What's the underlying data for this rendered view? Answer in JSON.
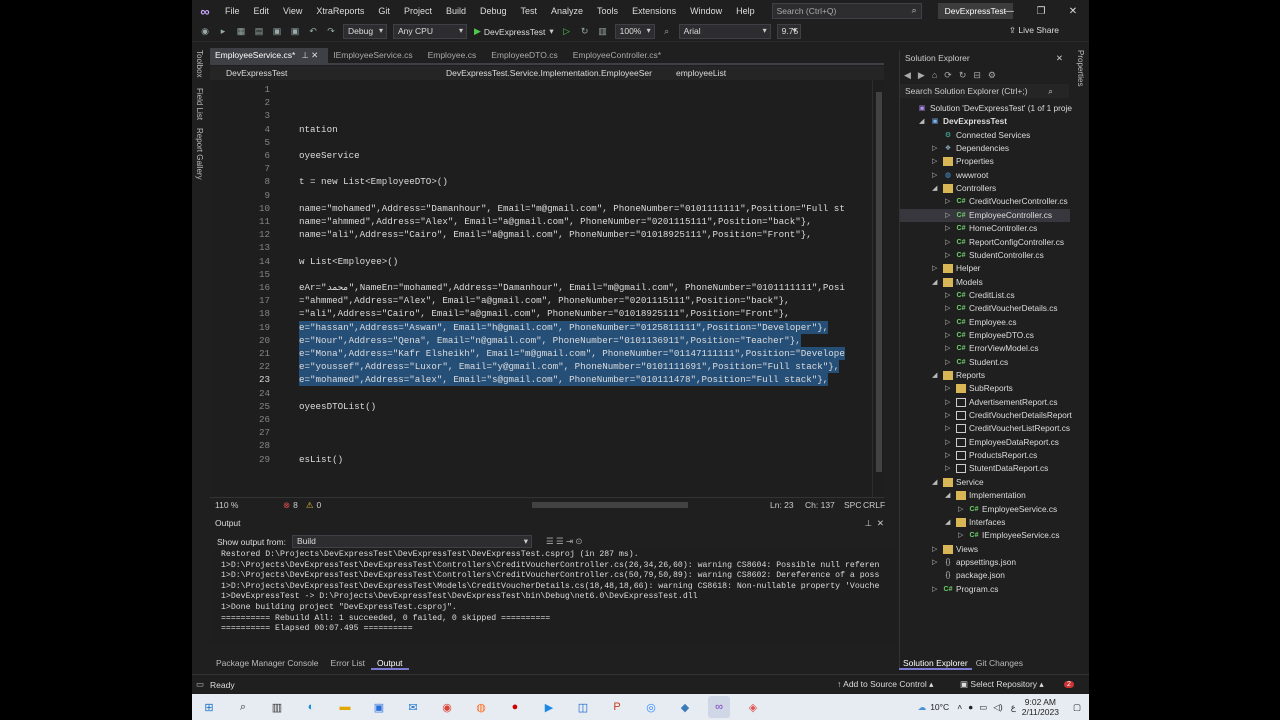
{
  "titlebar": {
    "menu": [
      "File",
      "Edit",
      "View",
      "XtraReports",
      "Git",
      "Project",
      "Build",
      "Debug",
      "Test",
      "Analyze",
      "Tools",
      "Extensions",
      "Window",
      "Help"
    ],
    "search_placeholder": "Search (Ctrl+Q)",
    "solution_name": "DevExpressTest"
  },
  "toolbar": {
    "config": "Debug",
    "platform": "Any CPU",
    "run_target": "DevExpressTest",
    "zoom": "100%",
    "font": "Arial",
    "font_size": "9.75",
    "live_share": "Live Share"
  },
  "left_strip": [
    "Toolbox",
    "Field List",
    "Report Gallery"
  ],
  "right_strip": [
    "Properties"
  ],
  "tabs": [
    {
      "label": "EmployeeService.cs*",
      "active": true
    },
    {
      "label": "IEmployeeService.cs",
      "active": false
    },
    {
      "label": "Employee.cs",
      "active": false
    },
    {
      "label": "EmployeeDTO.cs",
      "active": false
    },
    {
      "label": "EmployeeController.cs*",
      "active": false
    }
  ],
  "navbar": {
    "project": "DevExpressTest",
    "type": "DevExpressTest.Service.Implementation.EmployeeSer",
    "member": "employeeList"
  },
  "code_lines": [
    {
      "n": "1",
      "t": ""
    },
    {
      "n": "2",
      "t": ""
    },
    {
      "n": "3",
      "t": ""
    },
    {
      "n": "4",
      "t": "ntation"
    },
    {
      "n": "5",
      "t": ""
    },
    {
      "n": "6",
      "t": "oyeeService"
    },
    {
      "n": "7",
      "t": ""
    },
    {
      "n": "8",
      "t": "t = new List<EmployeeDTO>()"
    },
    {
      "n": "9",
      "t": ""
    },
    {
      "n": "10",
      "t": "name=\"mohamed\",Address=\"Damanhour\", Email=\"m@gmail.com\", PhoneNumber=\"0101111111\",Position=\"Full st"
    },
    {
      "n": "11",
      "t": "name=\"ahmmed\",Address=\"Alex\", Email=\"a@gmail.com\", PhoneNumber=\"0201115111\",Position=\"back\"},"
    },
    {
      "n": "12",
      "t": "name=\"ali\",Address=\"Cairo\", Email=\"a@gmail.com\", PhoneNumber=\"01018925111\",Position=\"Front\"},"
    },
    {
      "n": "13",
      "t": ""
    },
    {
      "n": "14",
      "t": "w List<Employee>()"
    },
    {
      "n": "15",
      "t": ""
    },
    {
      "n": "16",
      "t": "eAr=\"محمد\",NameEn=\"mohamed\",Address=\"Damanhour\", Email=\"m@gmail.com\", PhoneNumber=\"0101111111\",Posi"
    },
    {
      "n": "17",
      "t": "=\"ahmmed\",Address=\"Alex\", Email=\"a@gmail.com\", PhoneNumber=\"0201115111\",Position=\"back\"},"
    },
    {
      "n": "18",
      "t": "=\"ali\",Address=\"Cairo\", Email=\"a@gmail.com\", PhoneNumber=\"01018925111\",Position=\"Front\"},"
    },
    {
      "n": "19",
      "t": "e=\"hassan\",Address=\"Aswan\", Email=\"h@gmail.com\", PhoneNumber=\"0125811111\",Position=\"Developer\"},"
    },
    {
      "n": "20",
      "t": "e=\"Nour\",Address=\"Qena\", Email=\"n@gmail.com\", PhoneNumber=\"0101136911\",Position=\"Teacher\"},"
    },
    {
      "n": "21",
      "t": "e=\"Mona\",Address=\"Kafr Elsheikh\", Email=\"m@gmail.com\", PhoneNumber=\"01147111111\",Position=\"Develope"
    },
    {
      "n": "22",
      "t": "e=\"youssef\",Address=\"Luxor\", Email=\"y@gmail.com\", PhoneNumber=\"0101111691\",Position=\"Full stack\"},"
    },
    {
      "n": "23",
      "t": "e=\"mohamed\",Address=\"alex\", Email=\"s@gmail.com\", PhoneNumber=\"010111478\",Position=\"Full stack\"},"
    },
    {
      "n": "24",
      "t": ""
    },
    {
      "n": "25",
      "t": "oyeesDTOList()"
    },
    {
      "n": "26",
      "t": ""
    },
    {
      "n": "27",
      "t": ""
    },
    {
      "n": "28",
      "t": ""
    },
    {
      "n": "29",
      "t": "esList()"
    }
  ],
  "editor_status": {
    "zoom": "110 %",
    "errors": "8",
    "warnings": "0",
    "line": "Ln: 23",
    "col": "Ch: 137",
    "spc": "SPC",
    "crlf": "CRLF"
  },
  "output": {
    "title": "Output",
    "show_from_label": "Show output from:",
    "source": "Build",
    "lines": [
      "Restored D:\\Projects\\DevExpressTest\\DevExpressTest\\DevExpressTest.csproj (in 287 ms).",
      "1>D:\\Projects\\DevExpressTest\\DevExpressTest\\Controllers\\CreditVoucherController.cs(26,34,26,60): warning CS8604: Possible null referen",
      "1>D:\\Projects\\DevExpressTest\\DevExpressTest\\Controllers\\CreditVoucherController.cs(50,79,50,89): warning CS8602: Dereference of a poss",
      "1>D:\\Projects\\DevExpressTest\\DevExpressTest\\Models\\CreditVoucherDetails.cs(18,48,18,66): warning CS8618: Non-nullable property 'Vouche",
      "1>DevExpressTest -> D:\\Projects\\DevExpressTest\\DevExpressTest\\bin\\Debug\\net6.0\\DevExpressTest.dll",
      "1>Done building project \"DevExpressTest.csproj\".",
      "========== Rebuild All: 1 succeeded, 0 failed, 0 skipped ==========",
      "========== Elapsed 00:07.495 =========="
    ]
  },
  "bottom_tabs": [
    "Package Manager Console",
    "Error List",
    "Output"
  ],
  "solution_explorer": {
    "title": "Solution Explorer",
    "search": "Search Solution Explorer (Ctrl+;)",
    "items": [
      {
        "label": "Solution 'DevExpressTest' (1 of 1 proje",
        "depth": 0,
        "kind": "sln"
      },
      {
        "label": "DevExpressTest",
        "depth": 1,
        "kind": "proj",
        "open": true
      },
      {
        "label": "Connected Services",
        "depth": 2,
        "kind": "svc"
      },
      {
        "label": "Dependencies",
        "depth": 2,
        "kind": "dep",
        "arrow": true
      },
      {
        "label": "Properties",
        "depth": 2,
        "kind": "folder",
        "arrow": true
      },
      {
        "label": "wwwroot",
        "depth": 2,
        "kind": "globe",
        "arrow": true
      },
      {
        "label": "Controllers",
        "depth": 2,
        "kind": "folder",
        "open": true
      },
      {
        "label": "CreditVoucherController.cs",
        "depth": 3,
        "kind": "cs",
        "arrow": true
      },
      {
        "label": "EmployeeController.cs",
        "depth": 3,
        "kind": "cs",
        "arrow": true,
        "selected": true
      },
      {
        "label": "HomeController.cs",
        "depth": 3,
        "kind": "cs",
        "arrow": true
      },
      {
        "label": "ReportConfigController.cs",
        "depth": 3,
        "kind": "cs",
        "arrow": true
      },
      {
        "label": "StudentController.cs",
        "depth": 3,
        "kind": "cs",
        "arrow": true
      },
      {
        "label": "Helper",
        "depth": 2,
        "kind": "folder",
        "arrow": true
      },
      {
        "label": "Models",
        "depth": 2,
        "kind": "folder",
        "open": true
      },
      {
        "label": "CreditList.cs",
        "depth": 3,
        "kind": "cs",
        "arrow": true
      },
      {
        "label": "CreditVoucherDetails.cs",
        "depth": 3,
        "kind": "cs",
        "arrow": true
      },
      {
        "label": "Employee.cs",
        "depth": 3,
        "kind": "cs",
        "arrow": true
      },
      {
        "label": "EmployeeDTO.cs",
        "depth": 3,
        "kind": "cs",
        "arrow": true
      },
      {
        "label": "ErrorViewModel.cs",
        "depth": 3,
        "kind": "cs",
        "arrow": true
      },
      {
        "label": "Student.cs",
        "depth": 3,
        "kind": "cs",
        "arrow": true
      },
      {
        "label": "Reports",
        "depth": 2,
        "kind": "folder",
        "open": true
      },
      {
        "label": "SubReports",
        "depth": 3,
        "kind": "folder",
        "arrow": true
      },
      {
        "label": "AdvertisementReport.cs",
        "depth": 3,
        "kind": "rep",
        "arrow": true
      },
      {
        "label": "CreditVoucherDetailsReport.",
        "depth": 3,
        "kind": "rep",
        "arrow": true
      },
      {
        "label": "CreditVoucherListReport.cs",
        "depth": 3,
        "kind": "rep",
        "arrow": true
      },
      {
        "label": "EmployeeDataReport.cs",
        "depth": 3,
        "kind": "rep",
        "arrow": true
      },
      {
        "label": "ProductsReport.cs",
        "depth": 3,
        "kind": "rep",
        "arrow": true
      },
      {
        "label": "StutentDataReport.cs",
        "depth": 3,
        "kind": "rep",
        "arrow": true
      },
      {
        "label": "Service",
        "depth": 2,
        "kind": "folder",
        "open": true
      },
      {
        "label": "Implementation",
        "depth": 3,
        "kind": "folder",
        "open": true
      },
      {
        "label": "EmployeeService.cs",
        "depth": 4,
        "kind": "cs",
        "arrow": true
      },
      {
        "label": "Interfaces",
        "depth": 3,
        "kind": "folder",
        "open": true
      },
      {
        "label": "IEmployeeService.cs",
        "depth": 4,
        "kind": "cs",
        "arrow": true
      },
      {
        "label": "Views",
        "depth": 2,
        "kind": "folder",
        "arrow": true
      },
      {
        "label": "appsettings.json",
        "depth": 2,
        "kind": "json",
        "arrow": true
      },
      {
        "label": "package.json",
        "depth": 2,
        "kind": "json"
      },
      {
        "label": "Program.cs",
        "depth": 2,
        "kind": "cs",
        "arrow": true
      }
    ],
    "bottom_tabs": [
      "Solution Explorer",
      "Git Changes"
    ]
  },
  "statusbar": {
    "ready": "Ready",
    "add_source": "Add to Source Control",
    "select_repo": "Select Repository"
  },
  "taskbar": {
    "weather": "10°C",
    "time": "9:02 AM",
    "date": "2/11/2023",
    "lang": "ع"
  },
  "colors": {
    "accent": "#7a7ad0",
    "selection": "#264f78",
    "string": "#d69d85",
    "keyword": "#569cd6",
    "type": "#4ec9b0"
  }
}
